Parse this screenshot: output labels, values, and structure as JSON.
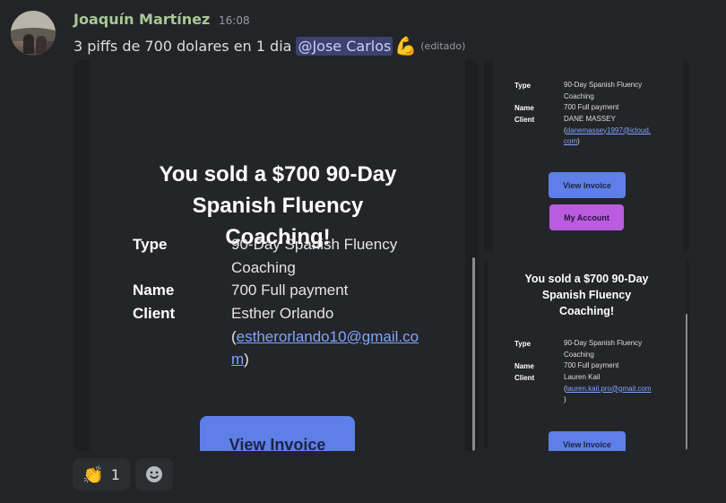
{
  "message": {
    "username": "Joaquín Martínez",
    "timestamp": "16:08",
    "text": "3 piffs de 700 dolares en 1 dia",
    "mention": "@Jose Carlos",
    "emoji": "💪",
    "edited": "(editado)"
  },
  "image_main": {
    "title_lines": [
      "You sold a $700 90-Day",
      "Spanish Fluency",
      "Coaching!"
    ],
    "type_label": "Type",
    "type_value_lines": [
      "90-Day Spanish Fluency",
      "Coaching"
    ],
    "name_label": "Name",
    "name_value": "700 Full payment",
    "client_label": "Client",
    "client_name": "Esther Orlando",
    "client_email_lines": [
      "(",
      "estherorlando10@gmail.co",
      "m",
      ")"
    ],
    "button": "View Invoice"
  },
  "image_top_right": {
    "type_label": "Type",
    "type_value_lines": [
      "90-Day Spanish Fluency",
      "Coaching"
    ],
    "name_label": "Name",
    "name_value": "700 Full payment",
    "client_label": "Client",
    "client_name": "DANE MASSEY",
    "client_email_lines": [
      "(",
      "danemassey1997@icloud.",
      "com",
      ")"
    ],
    "button_invoice": "View Invoice",
    "button_account": "My Account"
  },
  "image_bottom_right": {
    "title_lines": [
      "You sold a $700 90-Day",
      "Spanish Fluency",
      "Coaching!"
    ],
    "type_label": "Type",
    "type_value_lines": [
      "90-Day Spanish Fluency",
      "Coaching"
    ],
    "name_label": "Name",
    "name_value": "700 Full payment",
    "client_label": "Client",
    "client_name": "Lauren Kail",
    "client_email_lines": [
      "(",
      "lauren.kail.pro@gmail.com",
      ")"
    ],
    "button": "View Invoice"
  },
  "reactions": [
    {
      "icon": "clapping-hands-icon",
      "emoji": "👏",
      "count": "1"
    }
  ],
  "colors": {
    "background": "#232428",
    "username": "#a8c897",
    "mention_bg": "#3c4270",
    "button_invoice": "#5e7fe8",
    "button_account": "#b95ce0",
    "link": "#7fa4ff"
  }
}
